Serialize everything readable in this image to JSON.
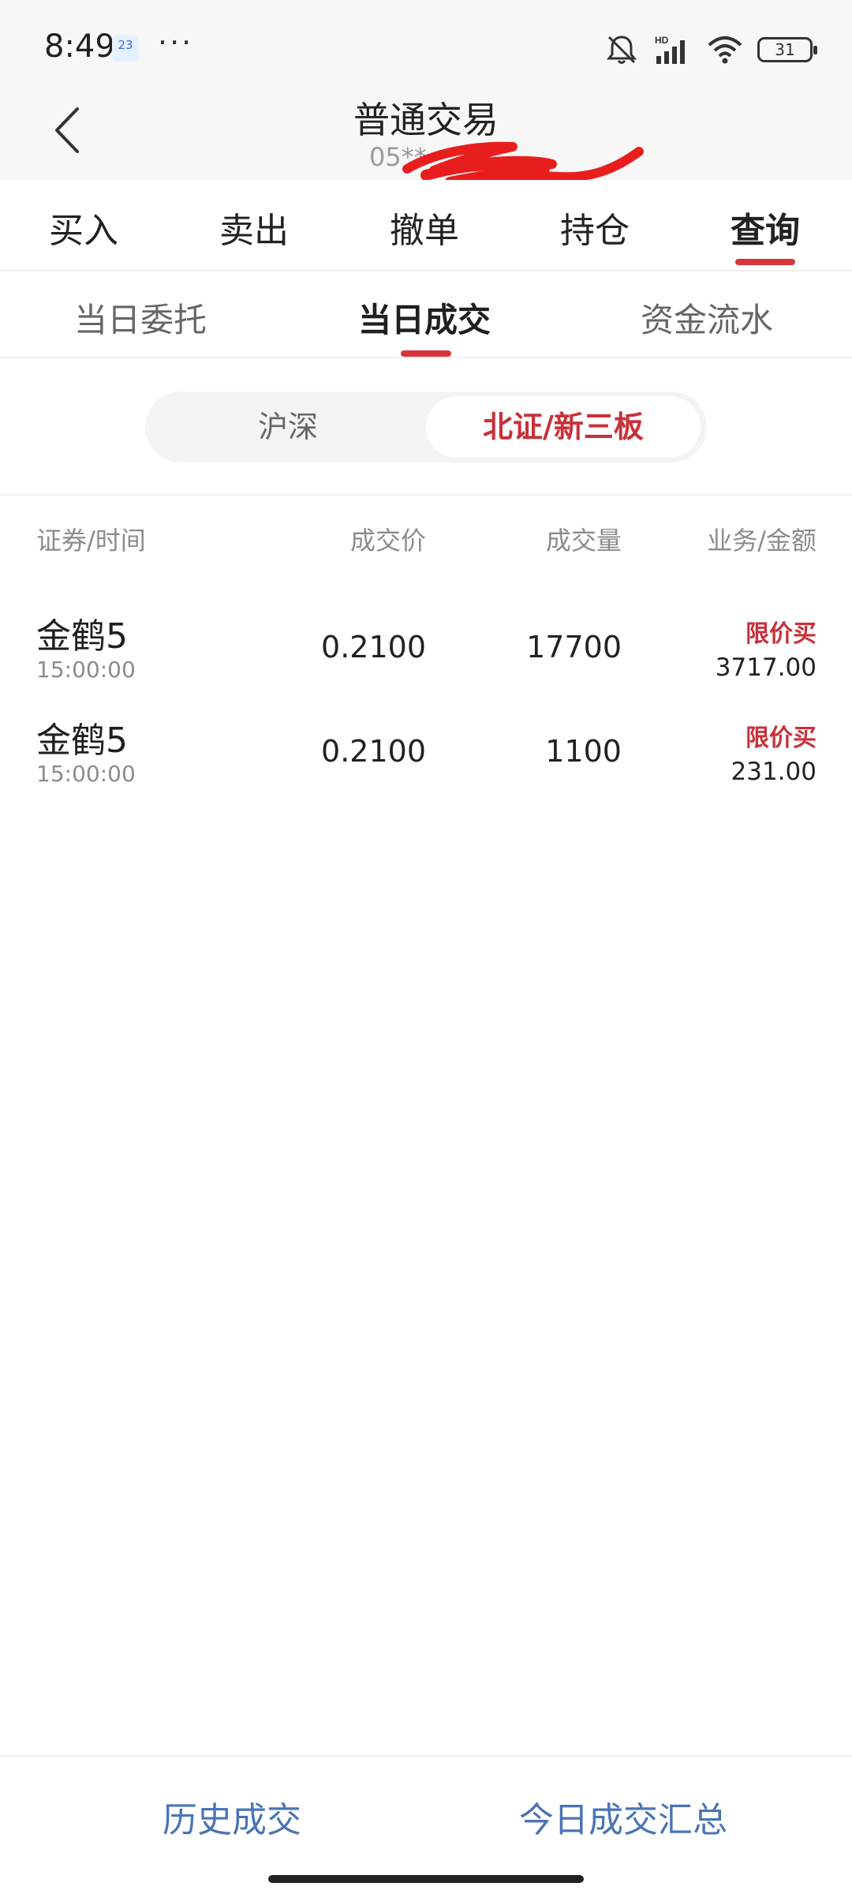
{
  "status_bar": {
    "time": "8:49",
    "calendar_day": "23",
    "more": "···",
    "battery": "31",
    "icons": [
      "calendar-icon",
      "mute-icon",
      "hd-signal-icon",
      "wifi-icon",
      "battery-icon"
    ]
  },
  "header": {
    "title": "普通交易",
    "account": "05**",
    "back_icon": "back-chevron-icon"
  },
  "main_tabs": [
    {
      "label": "买入"
    },
    {
      "label": "卖出"
    },
    {
      "label": "撤单"
    },
    {
      "label": "持仓"
    },
    {
      "label": "查询",
      "active": true
    }
  ],
  "sub_tabs": [
    {
      "label": "当日委托"
    },
    {
      "label": "当日成交",
      "active": true
    },
    {
      "label": "资金流水"
    }
  ],
  "segment": {
    "left": "沪深",
    "right": "北证/新三板",
    "selected": "北证/新三板"
  },
  "table": {
    "headers": [
      "证券/时间",
      "成交价",
      "成交量",
      "业务/金额"
    ],
    "rows": [
      {
        "name": "金鹤5",
        "time": "15:00:00",
        "price": "0.2100",
        "qty": "17700",
        "type": "限价买",
        "amount": "3717.00"
      },
      {
        "name": "金鹤5",
        "time": "15:00:00",
        "price": "0.2100",
        "qty": "1100",
        "type": "限价买",
        "amount": "231.00"
      }
    ]
  },
  "bottom": {
    "history": "历史成交",
    "summary": "今日成交汇总"
  },
  "colors": {
    "accent_red": "#d8363b",
    "link_blue": "#4a74b6",
    "header_bg": "#f7f7f7"
  }
}
